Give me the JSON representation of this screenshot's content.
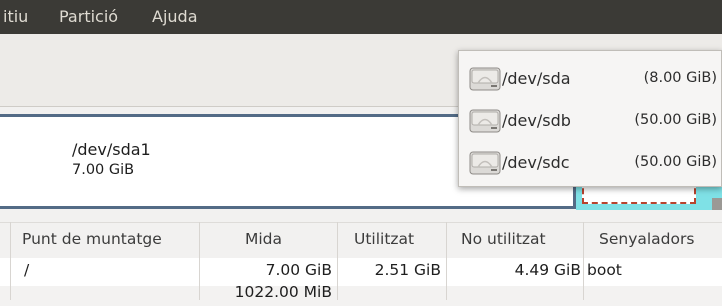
{
  "menubar": {
    "items": [
      "itiu",
      "Partició",
      "Ajuda"
    ]
  },
  "partition_map": {
    "name": "/dev/sda1",
    "size": "7.00 GiB"
  },
  "device_menu": {
    "items": [
      {
        "path": "/dev/sda",
        "size": "(8.00 GiB)"
      },
      {
        "path": "/dev/sdb",
        "size": "(50.00 GiB)"
      },
      {
        "path": "/dev/sdc",
        "size": "(50.00 GiB)"
      }
    ]
  },
  "table": {
    "columns": [
      "Punt de muntatge",
      "Mida",
      "Utilitzat",
      "No utilitzat",
      "Senyaladors"
    ],
    "rows": [
      [
        "/",
        "7.00 GiB",
        "2.51 GiB",
        "4.49 GiB",
        "boot"
      ],
      [
        "",
        "1022.00 MiB",
        "",
        "",
        ""
      ]
    ]
  },
  "colors": {
    "menubar": "#3b3a36",
    "partition_border": "#536b86",
    "unallocated": "#7fe1e6",
    "selection": "#b8432e"
  }
}
